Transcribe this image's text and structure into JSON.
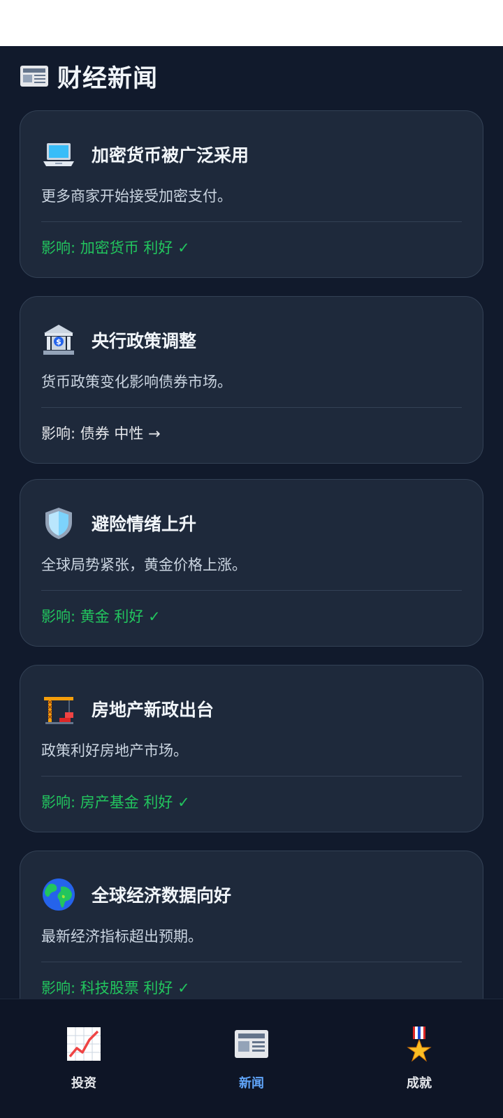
{
  "header": {
    "title": "财经新闻",
    "icon": "newspaper-icon"
  },
  "news": [
    {
      "icon": "laptop-icon",
      "title": "加密货币被广泛采用",
      "description": "更多商家开始接受加密支付。",
      "impact": "影响: 加密货币 利好 ✓",
      "impact_color": "#22c55e"
    },
    {
      "icon": "bank-icon",
      "title": "央行政策调整",
      "description": "货币政策变化影响债券市场。",
      "impact": "影响: 债券 中性 →",
      "impact_color": "#e5e7eb"
    },
    {
      "icon": "shield-icon",
      "title": "避险情绪上升",
      "description": "全球局势紧张，黄金价格上涨。",
      "impact": "影响: 黄金 利好 ✓",
      "impact_color": "#22c55e"
    },
    {
      "icon": "crane-icon",
      "title": "房地产新政出台",
      "description": "政策利好房地产市场。",
      "impact": "影响: 房产基金 利好 ✓",
      "impact_color": "#22c55e"
    },
    {
      "icon": "globe-icon",
      "title": "全球经济数据向好",
      "description": "最新经济指标超出预期。",
      "impact": "影响: 科技股票 利好 ✓",
      "impact_color": "#22c55e"
    }
  ],
  "nav": {
    "items": [
      {
        "icon": "chart-up-icon",
        "label": "投资",
        "active": false
      },
      {
        "icon": "newspaper-icon",
        "label": "新闻",
        "active": true
      },
      {
        "icon": "medal-icon",
        "label": "成就",
        "active": false
      }
    ],
    "active_color": "#60a5fa"
  }
}
